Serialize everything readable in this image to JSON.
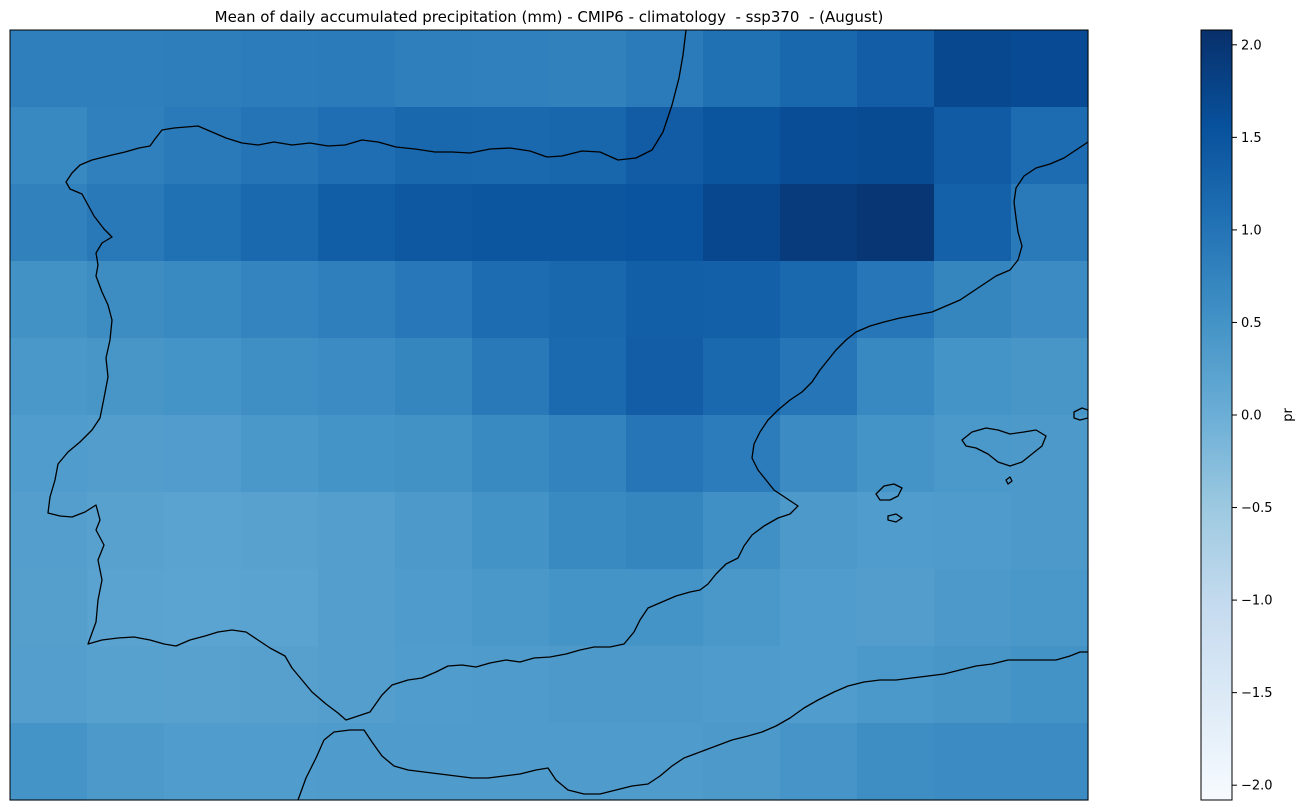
{
  "chart_data": {
    "type": "heatmap",
    "title": "Mean of daily accumulated precipitation (mm) - CMIP6 - climatology  - ssp370  - (August)",
    "colorbar": {
      "label": "pr",
      "range": [
        -2.08,
        2.08
      ],
      "ticks": [
        2.0,
        1.5,
        1.0,
        0.5,
        0.0,
        -0.5,
        -1.0,
        -1.5,
        -2.0
      ],
      "tick_labels": [
        "2.0",
        "1.5",
        "1.0",
        "0.5",
        "0.0",
        "−0.5",
        "−1.0",
        "−1.5",
        "−2.0"
      ],
      "colormap": "Blues"
    },
    "grid_shape": [
      10,
      14
    ],
    "values": [
      [
        0.82,
        0.82,
        0.84,
        0.87,
        0.88,
        0.82,
        0.8,
        0.79,
        0.89,
        1.06,
        1.2,
        1.36,
        1.7,
        1.65
      ],
      [
        0.67,
        0.8,
        0.9,
        1.0,
        1.09,
        1.2,
        1.18,
        1.22,
        1.38,
        1.5,
        1.63,
        1.66,
        1.4,
        1.12
      ],
      [
        0.79,
        0.92,
        1.06,
        1.18,
        1.35,
        1.44,
        1.48,
        1.48,
        1.52,
        1.72,
        1.9,
        2.0,
        1.3,
        0.9
      ],
      [
        0.52,
        0.6,
        0.64,
        0.74,
        0.82,
        0.93,
        1.12,
        1.2,
        1.33,
        1.32,
        1.18,
        0.95,
        0.72,
        0.62
      ],
      [
        0.42,
        0.45,
        0.48,
        0.56,
        0.62,
        0.72,
        0.92,
        1.16,
        1.36,
        1.18,
        0.98,
        0.68,
        0.48,
        0.44
      ],
      [
        0.34,
        0.32,
        0.33,
        0.42,
        0.48,
        0.52,
        0.64,
        0.76,
        0.98,
        0.86,
        0.62,
        0.48,
        0.4,
        0.38
      ],
      [
        0.3,
        0.24,
        0.22,
        0.24,
        0.3,
        0.38,
        0.5,
        0.65,
        0.72,
        0.55,
        0.38,
        0.34,
        0.36,
        0.38
      ],
      [
        0.28,
        0.22,
        0.2,
        0.22,
        0.3,
        0.36,
        0.42,
        0.48,
        0.48,
        0.42,
        0.34,
        0.32,
        0.38,
        0.42
      ],
      [
        0.3,
        0.25,
        0.24,
        0.26,
        0.3,
        0.34,
        0.36,
        0.38,
        0.38,
        0.35,
        0.34,
        0.4,
        0.44,
        0.5
      ],
      [
        0.48,
        0.38,
        0.34,
        0.34,
        0.36,
        0.36,
        0.36,
        0.36,
        0.36,
        0.38,
        0.46,
        0.58,
        0.62,
        0.62
      ]
    ]
  }
}
